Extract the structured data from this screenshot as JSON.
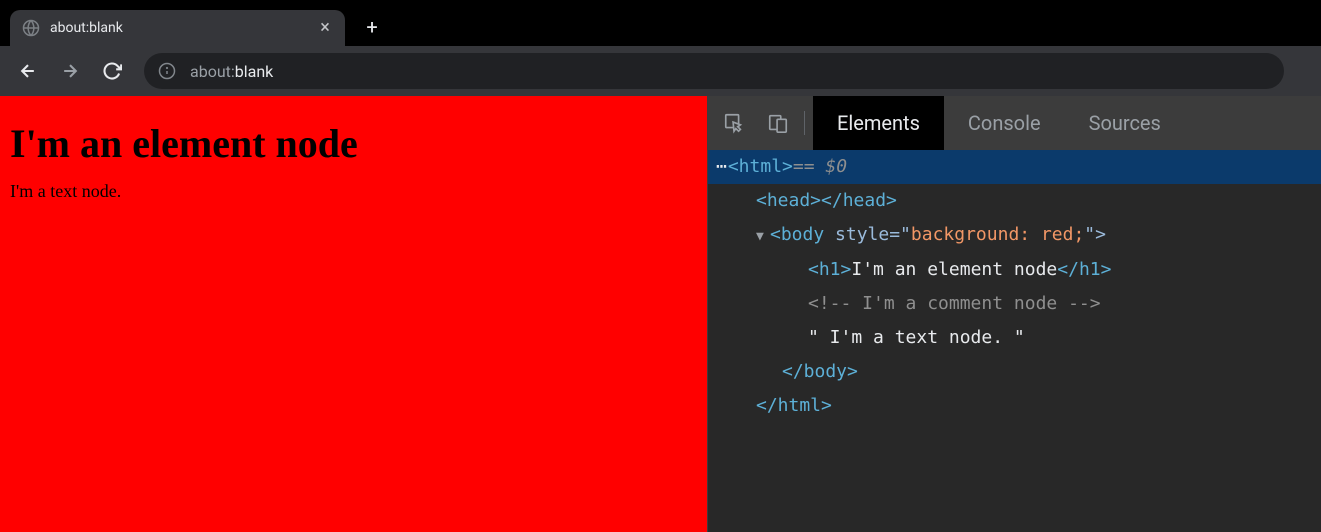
{
  "browser": {
    "tab_title": "about:blank",
    "url_prefix": "about:",
    "url_suffix": "blank"
  },
  "page": {
    "heading": "I'm an element node",
    "text": "I'm a text node."
  },
  "devtools": {
    "tabs": {
      "elements": "Elements",
      "console": "Console",
      "sources": "Sources"
    },
    "dom": {
      "html_open": "<html>",
      "selected_suffix": " == $0",
      "head": "<head></head>",
      "body_open_tag": "<body",
      "body_attr_name": " style",
      "body_attr_eq": "=\"",
      "body_attr_val": "background: red;",
      "body_attr_close": "\">",
      "h1_open": "<h1>",
      "h1_text": "I'm an element node",
      "h1_close": "</h1>",
      "comment": "<!-- I'm a comment node -->",
      "text_node": "\" I'm a text node. \"",
      "body_close": "</body>",
      "html_close": "</html>"
    }
  }
}
